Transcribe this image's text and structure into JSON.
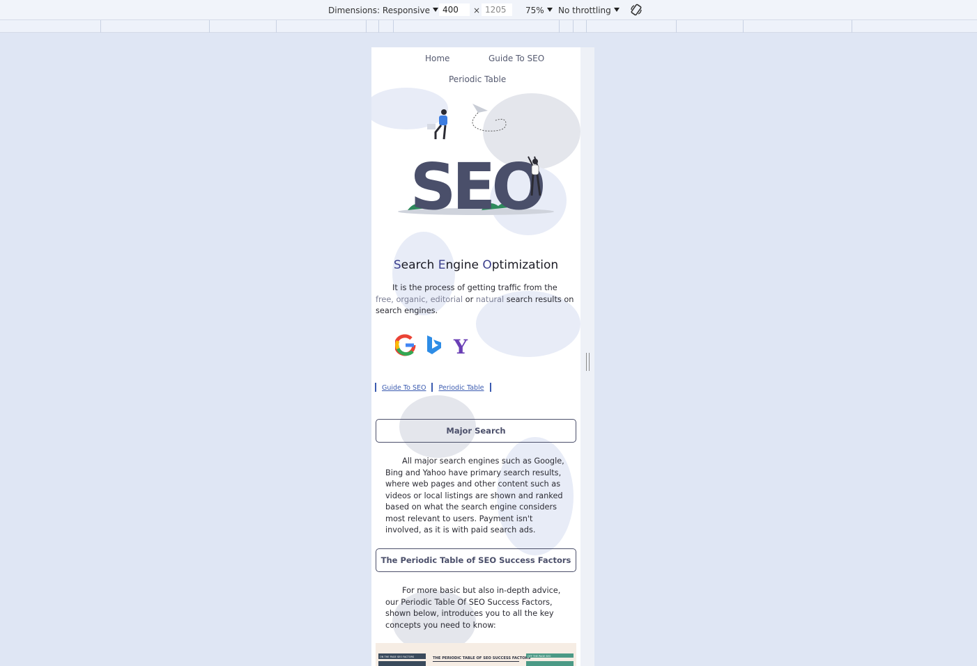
{
  "toolbar": {
    "dimensions_label": "Dimensions: Responsive",
    "width_value": "400",
    "times": "×",
    "height_value": "1205",
    "zoom_label": "75%",
    "throttle_label": "No throttling",
    "rotate_icon": "rotate-icon"
  },
  "nav": {
    "home": "Home",
    "guide": "Guide To SEO",
    "periodic": "Periodic Table"
  },
  "hero": {
    "logo_text": "SEO"
  },
  "title": {
    "c1": "S",
    "r1": "earch ",
    "c2": "E",
    "r2": "ngine ",
    "c3": "O",
    "r3": "ptimization"
  },
  "intro": {
    "p1": "It is the process of getting traffic from the ",
    "w1": "free,",
    "p2": " ",
    "w2": "organic, editorial",
    "p3": " or ",
    "w3": "natural",
    "p4": " search results on search engines."
  },
  "engines": [
    "google-icon",
    "bing-icon",
    "yahoo-icon"
  ],
  "links": {
    "guide": "Guide To SEO",
    "periodic": "Periodic Table"
  },
  "sections": {
    "major_title": "Major Search",
    "major_text": "All major search engines such as Google, Bing and Yahoo have primary search results, where web pages and other content such as videos or local listings are shown and ranked based on what the search engine considers most relevant to users. Payment isn't involved, as it is with paid search ads.",
    "periodic_title": "The Periodic Table of SEO Success Factors",
    "periodic_text": "For more basic but also in-depth advice, our Periodic Table Of SEO Success Factors, shown below, introduces you to all the key concepts you need to know:"
  },
  "infographic": {
    "left_header": "ON THE PAGE SEO FACTORS",
    "center_title": "THE PERIODIC TABLE OF SEO SUCCESS FACTORS",
    "right_header": "OFF THE PAGE SEO"
  },
  "colors": {
    "accent": "#3b3f8c",
    "blob": "#e8ecf7",
    "button_border": "#4b4f6a"
  }
}
